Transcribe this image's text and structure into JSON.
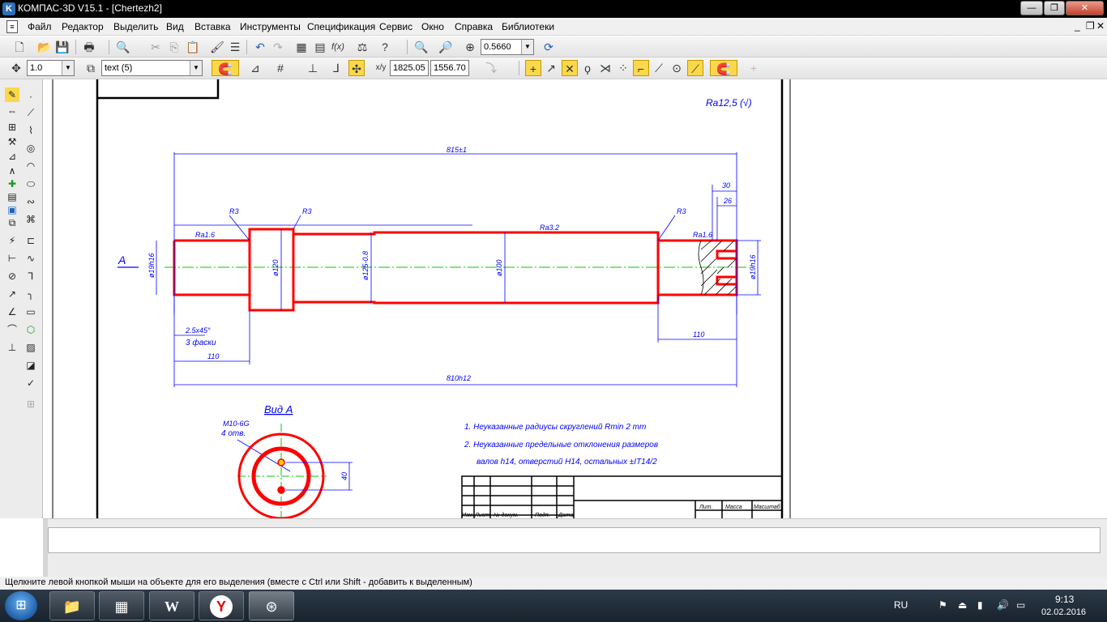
{
  "window": {
    "title": "КОМПАС-3D V15.1 - [Chertezh2]",
    "app_icon": "K",
    "buttons": {
      "minimize": "—",
      "restore": "❐",
      "close": "✕"
    }
  },
  "menu": {
    "items": [
      "Файл",
      "Редактор",
      "Выделить",
      "Вид",
      "Вставка",
      "Инструменты",
      "Спецификация",
      "Сервис",
      "Окно",
      "Справка",
      "Библиотеки"
    ],
    "doc_buttons": {
      "minimize": "_",
      "restore": "❐",
      "close": "✕"
    }
  },
  "toolbar1": {
    "zoom_value": "0.5660"
  },
  "toolbar2": {
    "step_value": "1.0",
    "style_value": "text (5)",
    "coord_x": "1825.05",
    "coord_y": "1556.70"
  },
  "drawing": {
    "roughness_symbol": "Ra12,5 (√)",
    "dim_overall_top": "815±1",
    "dim_overall_bottom": "810h12",
    "dim_left_step": "110",
    "dim_right_step": "110",
    "dim_slot_30": "30",
    "dim_slot_26": "26",
    "dia_left": "ø19h16",
    "dia_collar": "ø120",
    "dia_middle_left": "ø125-0.8",
    "dia_middle_right": "ø100",
    "dia_right": "ø19h16",
    "radius_1": "R3",
    "radius_2": "R3",
    "radius_3": "R3",
    "rough_left": "Ra1.6",
    "rough_mid": "Ra3.2",
    "rough_right": "Ra1.6",
    "chamfer": "2.5x45°",
    "chamfer_note": "3 фаски",
    "section_arrow_label": "A",
    "view_label": "Вид А",
    "thread_label": "М10-6G",
    "thread_count": "4 отв.",
    "dim_view": "40",
    "note_1": "1. Неуказанные радиусы скруглений Rmin 2 mm",
    "note_2": "2. Неуказанные предельные отклонения размеров",
    "note_3": "валов h14, отверстий H14, остальных ±IT14/2",
    "stamp_headers": [
      "Изм.",
      "Лист",
      "№ докум.",
      "Подп.",
      "Дата"
    ],
    "stamp_right_headers": [
      "Лит.",
      "Масса",
      "Масштаб"
    ]
  },
  "status": {
    "text": "Щелкните левой кнопкой мыши на объекте для его выделения (вместе с Ctrl или Shift - добавить к выделенным)"
  },
  "taskbar": {
    "lang": "RU",
    "time": "9:13",
    "date": "02.02.2016"
  },
  "colors": {
    "part_outline": "#ff0000",
    "axis": "#00cc00",
    "dimension": "#0000ff",
    "frame": "#000000",
    "highlight": "#fbd74b"
  }
}
